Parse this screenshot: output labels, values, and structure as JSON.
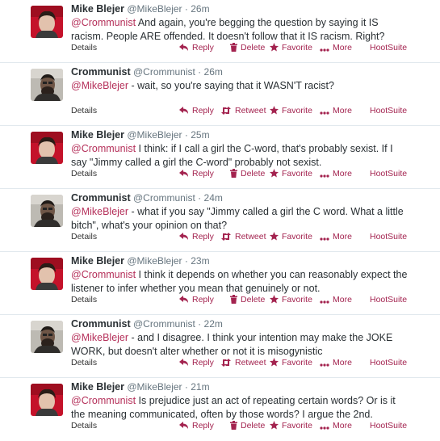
{
  "actions": {
    "details": "Details",
    "reply": "Reply",
    "delete": "Delete",
    "retweet": "Retweet",
    "favorite": "Favorite",
    "more": "More",
    "hootsuite": "HootSuite"
  },
  "colors": {
    "accent": "#a3234f",
    "mention": "#b5305a"
  },
  "tweets": [
    {
      "name": "Mike Blejer",
      "handle": "@MikeBlejer",
      "sep": "·",
      "time": "26m",
      "mention": "@Crommunist",
      "text": " And again, you're begging the question by saying it IS racism. People ARE offended. It doesn't follow that it IS racism. Right?",
      "own": true
    },
    {
      "name": "Crommunist",
      "handle": "@Crommunist",
      "sep": "·",
      "time": "26m",
      "mention": "@MikeBlejer",
      "text": " - wait, so you're saying that it WASN'T racist?",
      "own": false
    },
    {
      "name": "Mike Blejer",
      "handle": "@MikeBlejer",
      "sep": "·",
      "time": "25m",
      "mention": "@Crommunist",
      "text": " I think: if I call a girl the C-word, that's probably sexist. If I say \"Jimmy called a girl the C-word\" probably not sexist.",
      "own": true
    },
    {
      "name": "Crommunist",
      "handle": "@Crommunist",
      "sep": "·",
      "time": "24m",
      "mention": "@MikeBlejer",
      "text": " - what if you say \"Jimmy called a girl the C word. What a little bitch\", what's your opinion on that?",
      "own": false
    },
    {
      "name": "Mike Blejer",
      "handle": "@MikeBlejer",
      "sep": "·",
      "time": "23m",
      "mention": "@Crommunist",
      "text": " I think it depends on whether you can reasonably expect the listener to infer whether you mean that genuinely or not.",
      "own": true
    },
    {
      "name": "Crommunist",
      "handle": "@Crommunist",
      "sep": "·",
      "time": "22m",
      "mention": "@MikeBlejer",
      "text": " - and I disagree. I think your intention may make the JOKE WORK, but doesn't alter whether or not it is misogynistic",
      "own": false
    },
    {
      "name": "Mike Blejer",
      "handle": "@MikeBlejer",
      "sep": "·",
      "time": "21m",
      "mention": "@Crommunist",
      "text": " Is prejudice just an act of repeating certain words? Or is it the meaning communicated, often by those words? I argue the 2nd.",
      "own": true
    }
  ]
}
